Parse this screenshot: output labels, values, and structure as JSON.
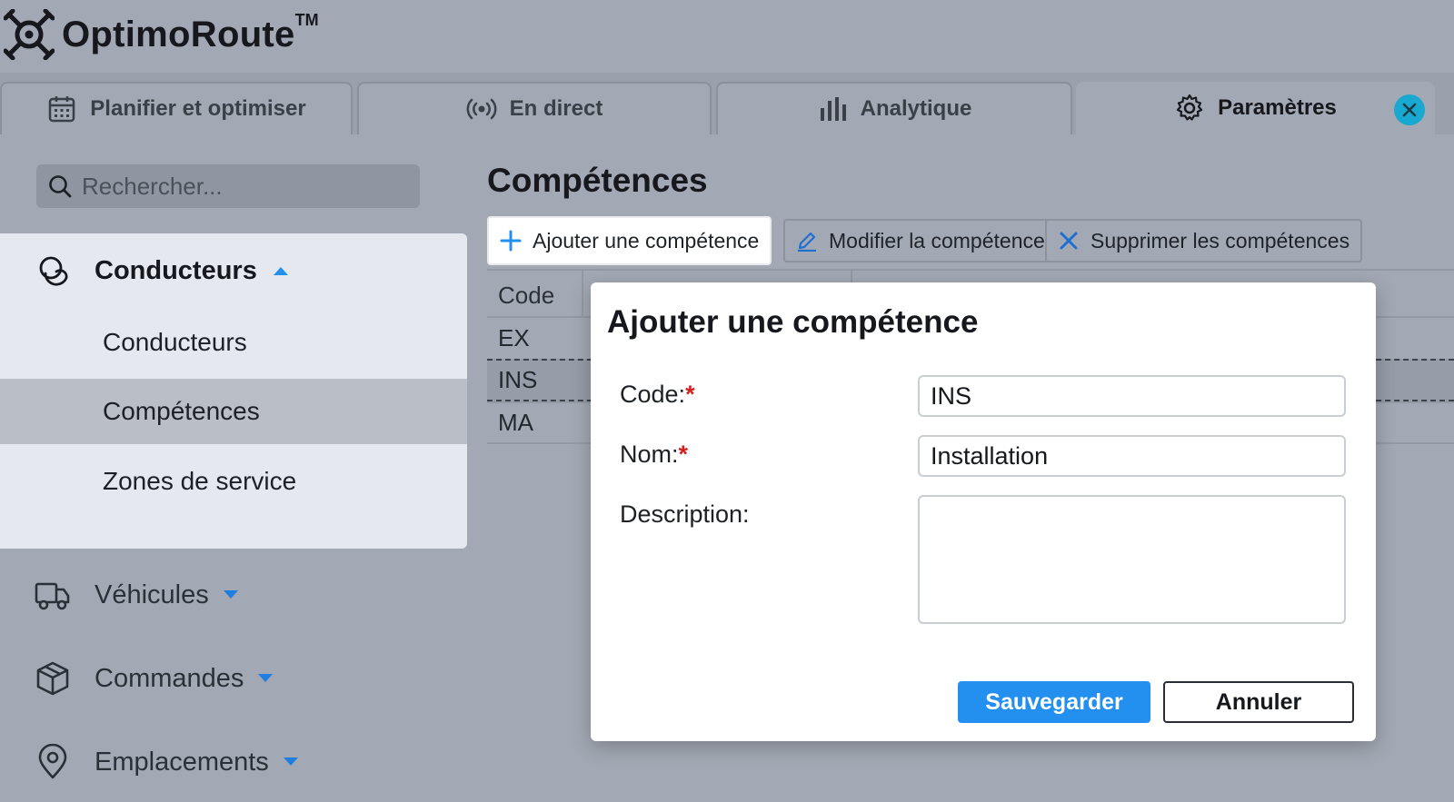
{
  "app": {
    "name": "OptimoRoute",
    "tm": "TM"
  },
  "tabs": [
    {
      "label": "Planifier et optimiser",
      "icon": "calendar-icon"
    },
    {
      "label": "En direct",
      "icon": "broadcast-icon"
    },
    {
      "label": "Analytique",
      "icon": "bar-chart-icon"
    },
    {
      "label": "Paramètres",
      "icon": "gear-icon",
      "active": true
    }
  ],
  "sidebar": {
    "search_placeholder": "Rechercher...",
    "groups": [
      {
        "label": "Conducteurs",
        "icon": "drivers-icon",
        "expanded": true,
        "items": [
          "Conducteurs",
          "Compétences",
          "Zones de service"
        ],
        "active_item": "Compétences"
      },
      {
        "label": "Véhicules",
        "icon": "truck-icon",
        "expanded": false
      },
      {
        "label": "Commandes",
        "icon": "package-icon",
        "expanded": false
      },
      {
        "label": "Emplacements",
        "icon": "location-pin-icon",
        "expanded": false
      }
    ]
  },
  "main": {
    "title": "Compétences",
    "toolbar": {
      "add": "Ajouter une compétence",
      "edit": "Modifier la compétence",
      "delete": "Supprimer les compétences"
    },
    "grid": {
      "columns": [
        "Code"
      ],
      "rows": [
        "EX",
        "INS",
        "MA"
      ],
      "selected_row": "INS"
    }
  },
  "modal": {
    "title": "Ajouter une compétence",
    "fields": {
      "code_label": "Code:",
      "code_value": "INS",
      "name_label": "Nom:",
      "name_value": "Installation",
      "description_label": "Description:",
      "description_value": "",
      "required_mark": "*"
    },
    "save": "Sauvegarder",
    "cancel": "Annuler"
  },
  "colors": {
    "primary": "#2390f0",
    "close": "#19a8cf",
    "required": "#d32020"
  }
}
